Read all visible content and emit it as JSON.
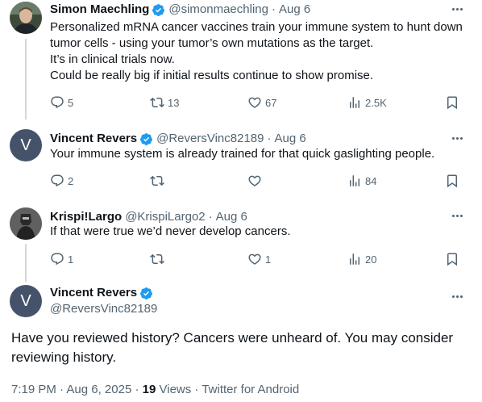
{
  "colors": {
    "verified": "#1d9bf0",
    "muted": "#536471",
    "text": "#0f1419",
    "thread_line": "#cfd9de"
  },
  "replies": [
    {
      "name": "Simon Maechling",
      "handle": "@simonmaechling",
      "separator": "·",
      "date": "Aug 6",
      "text": "Personalized mRNA cancer vaccines train your immune system to hunt down tumor cells -  using your tumor’s own mutations as the target.\nIt’s in clinical trials now.\nCould be really big if initial results continue to show promise.",
      "replies_count": "5",
      "reposts_count": "13",
      "likes_count": "67",
      "views_count": "2.5K"
    },
    {
      "name": "Vincent Revers",
      "handle": "@ReversVinc82189",
      "separator": "·",
      "date": "Aug 6",
      "avatar_letter": "V",
      "text": "Your immune system is already trained for that quick gaslighting people.",
      "replies_count": "2",
      "reposts_count": "",
      "likes_count": "",
      "views_count": "84"
    },
    {
      "name": "Krispi!Largo",
      "handle": "@KrispiLargo2",
      "separator": "·",
      "date": "Aug 6",
      "text": "If that were true we’d never develop cancers.",
      "replies_count": "1",
      "reposts_count": "",
      "likes_count": "1",
      "views_count": "20"
    }
  ],
  "main": {
    "name": "Vincent Revers",
    "handle": "@ReversVinc82189",
    "avatar_letter": "V",
    "text": "Have you reviewed history? Cancers were unheard of. You may consider reviewing history.",
    "time": "7:19 PM",
    "date": "Aug 6, 2025",
    "separator": "·",
    "views_count": "19",
    "views_label": "Views",
    "source": "Twitter for Android"
  }
}
